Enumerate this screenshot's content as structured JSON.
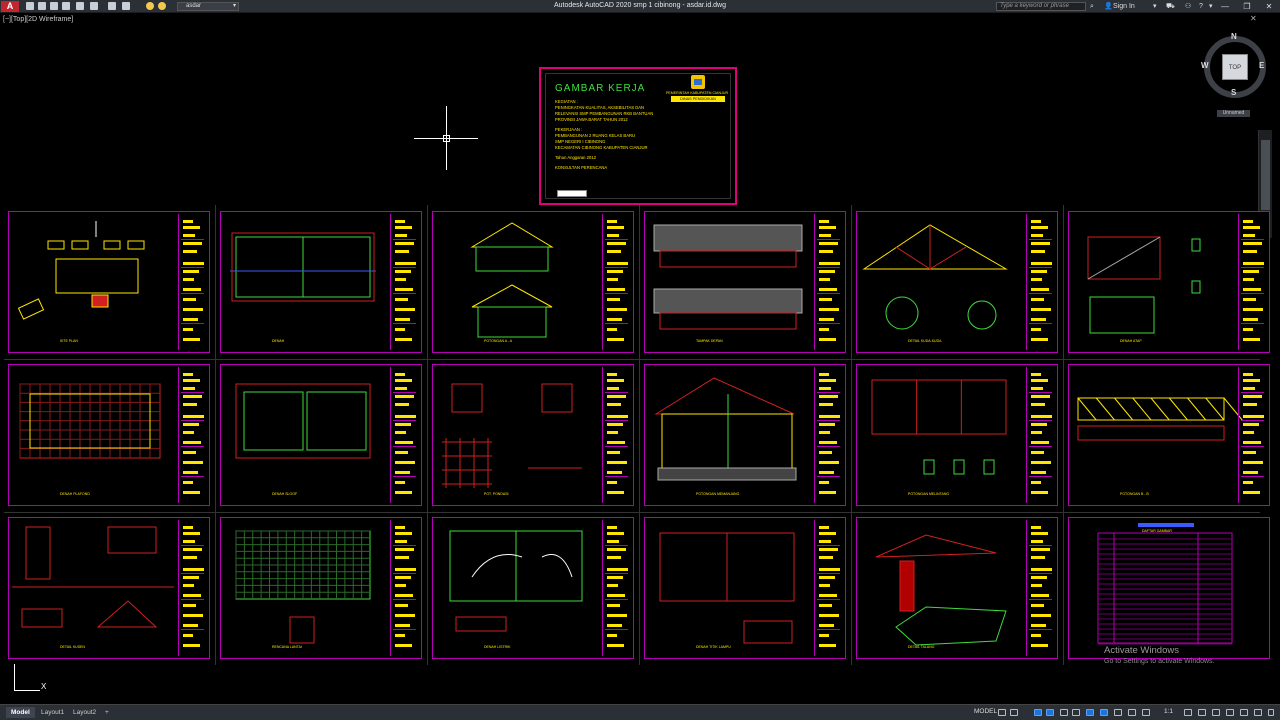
{
  "app": {
    "title": "Autodesk AutoCAD 2020   smp 1 cibinong - asdar.id.dwg",
    "logo_letter": "A",
    "workspace_select": "asdar"
  },
  "toolbar": {
    "icons": [
      "new-icon",
      "open-icon",
      "save-icon",
      "saveas-icon",
      "print-icon",
      "undo-icon",
      "redo-icon",
      "lightbulb-icon",
      "layer-icon"
    ]
  },
  "header": {
    "search_placeholder": "Type a keyword or phrase",
    "sign_in": "Sign In",
    "help": "?"
  },
  "window_controls": {
    "minimize": "—",
    "maximize": "❐",
    "close": "✕"
  },
  "viewport": {
    "label": "[−][Top][2D Wireframe]",
    "close_doc": "✕"
  },
  "viewcube": {
    "face": "TOP",
    "north": "N",
    "south": "S",
    "east": "E",
    "west": "W",
    "wcs": "Unnamed"
  },
  "cover": {
    "title": "GAMBAR KERJA",
    "lines": [
      "KEGIATAN :",
      "PENINGKATAN KUALITAS, AKSEBILITAS DAN",
      "RELEVANSI SMP PEMBANGUNAN RKB BANTUAN",
      "PROVINSI JAWA BARAT TAHUN 2012",
      "",
      "PEKERJAAN :",
      "PEMBANGUNAN 2 RUANG KELAS BARU",
      "SMP NEGERI I CIBINONG",
      "KECAMATAN CIBINONG KABUPATEN CIANJUR",
      "",
      "Tahun Anggaran 2012",
      "",
      "KONSULTAN PERENCANA"
    ],
    "institution": "PEMERINTAH KABUPATEN CIANJUR",
    "dinas": "DINAS PENDIDIKAN"
  },
  "sheets": {
    "row1": [
      "SITE PLAN",
      "DENAH",
      "POTONGAN A - A",
      "TAMPAK DEPAN",
      "DETAIL KUDA-KUDA",
      "DENAH ATAP"
    ],
    "row2": [
      "DENAH PLAFOND",
      "DENAH SLOOF",
      "POT. PONDASI",
      "POTONGAN MEMANJANG",
      "POTONGAN MELINTANG",
      "POTONGAN B - B"
    ],
    "row3": [
      "DETAIL KUSEN",
      "RENCANA LANTAI",
      "DENAH LISTRIK",
      "DENAH TITIK LAMPU",
      "DETAIL TALANG",
      "DAFTAR GAMBAR"
    ]
  },
  "watermark": {
    "line1": "Activate Windows",
    "line2": "Go to Settings to activate Windows."
  },
  "ucs": {
    "x_label": "X"
  },
  "statusbar": {
    "tabs": [
      "Model",
      "Layout1",
      "Layout2"
    ],
    "add_tab": "+",
    "model_label": "MODEL",
    "scale": "1:1"
  }
}
